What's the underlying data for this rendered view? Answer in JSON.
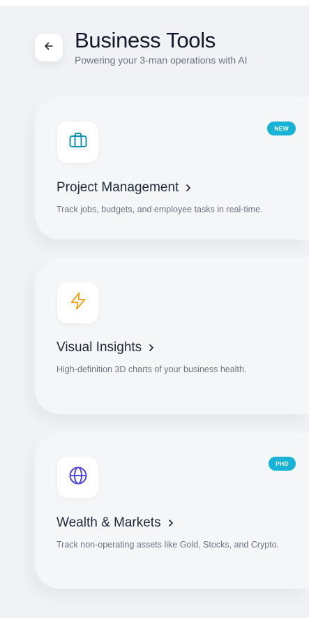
{
  "header": {
    "title": "Business Tools",
    "subtitle": "Powering your 3-man operations with AI"
  },
  "colors": {
    "background": "#f0f2f5",
    "card": "#f5f6f8",
    "badge": "#16b3d6",
    "project_icon": "#0e94b3",
    "insights_icon": "#f2a31b",
    "markets_icon": "#5147e0"
  },
  "cards": [
    {
      "icon": "briefcase-icon",
      "title": "Project Management",
      "description": "Track jobs, budgets, and employee tasks in real-time.",
      "badge": "NEW"
    },
    {
      "icon": "lightning-icon",
      "title": "Visual Insights",
      "description": "High-definition 3D charts of your business health."
    },
    {
      "icon": "globe-icon",
      "title": "Wealth & Markets",
      "description": "Track non-operating assets like Gold, Stocks, and Crypto.",
      "badge": "PHD"
    }
  ]
}
